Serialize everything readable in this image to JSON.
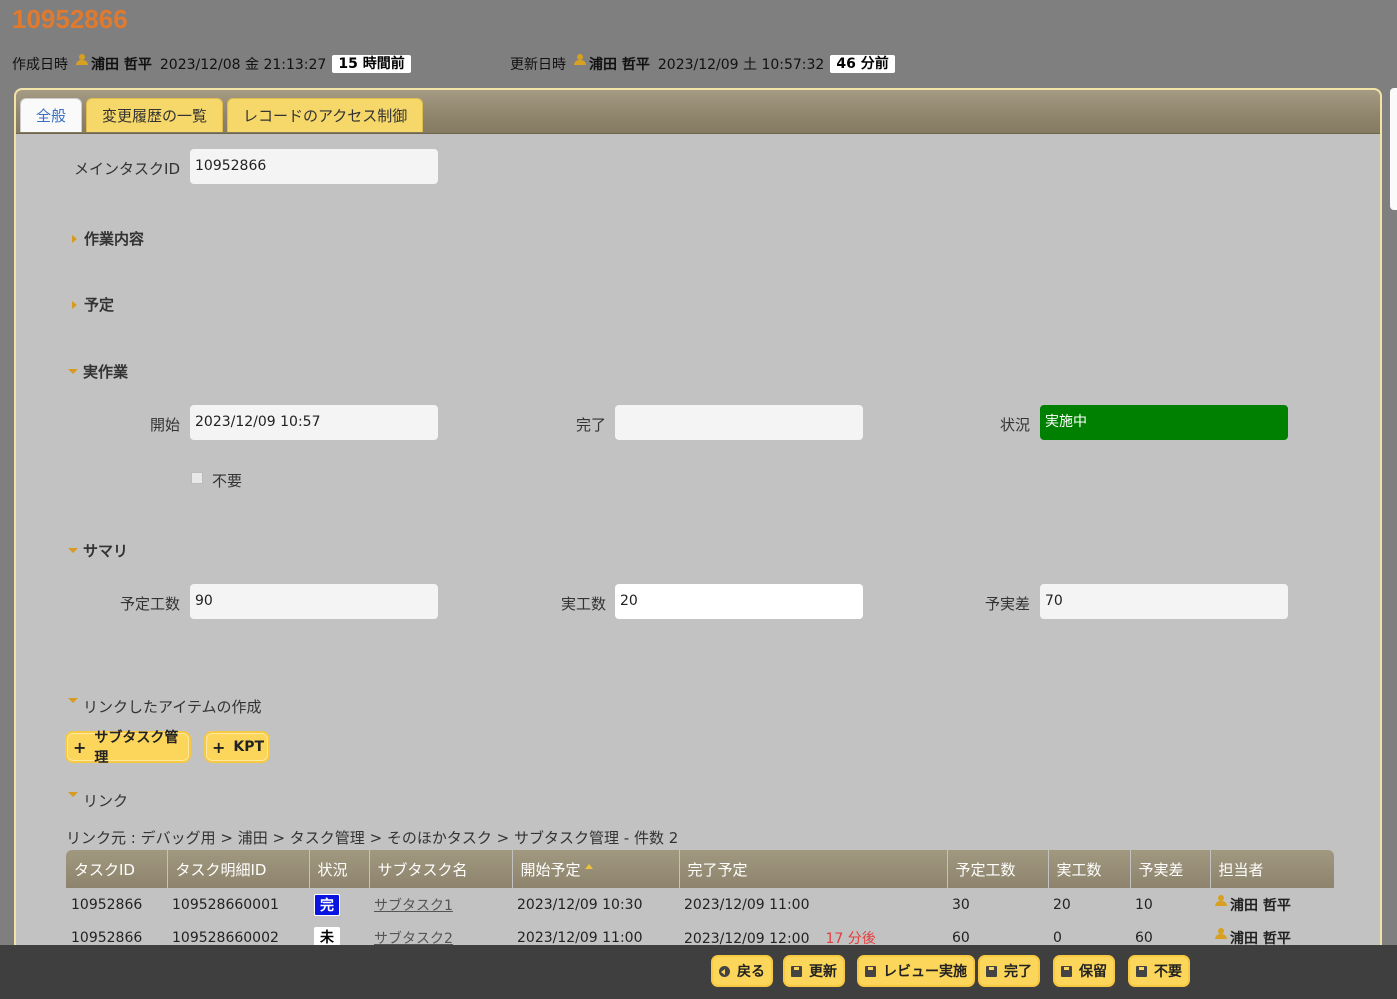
{
  "record": {
    "id": "10952866",
    "created_label": "作成日時",
    "created_user": "浦田 哲平",
    "created_date": "2023/12/08 金 21:13:27",
    "created_ago": "15 時間前",
    "updated_label": "更新日時",
    "updated_user": "浦田 哲平",
    "updated_date": "2023/12/09 土 10:57:32",
    "updated_ago": "46 分前"
  },
  "tabs": [
    {
      "label": "全般",
      "active": true
    },
    {
      "label": "変更履歴の一覧",
      "active": false
    },
    {
      "label": "レコードのアクセス制御",
      "active": false
    }
  ],
  "form": {
    "main_task_id_label": "メインタスクID",
    "main_task_id_value": "10952866",
    "sections": {
      "work_content": "作業内容",
      "plan": "予定",
      "actual": "実作業",
      "summary": "サマリ",
      "create_linked": "リンクしたアイテムの作成",
      "links": "リンク"
    },
    "start_label": "開始",
    "start_value": "2023/12/09 10:57",
    "complete_label": "完了",
    "complete_value": "",
    "status_label": "状況",
    "status_value": "実施中",
    "unneeded_label": "不要",
    "planned_hours_label": "予定工数",
    "planned_hours_value": "90",
    "actual_hours_label": "実工数",
    "actual_hours_value": "20",
    "diff_label": "予実差",
    "diff_value": "70"
  },
  "linked_buttons": {
    "subtask": "サブタスク管理",
    "kpt": "KPT"
  },
  "breadcrumb": "リンク元 : デバッグ用 > 浦田 > タスク管理 > そのほかタスク > サブタスク管理 - 件数 2",
  "table": {
    "headers": [
      "タスクID",
      "タスク明細ID",
      "状況",
      "サブタスク名",
      "開始予定",
      "完了予定",
      "予定工数",
      "実工数",
      "予実差",
      "担当者"
    ],
    "rows": [
      {
        "task_id": "10952866",
        "detail_id": "109528660001",
        "status": "完",
        "name": "サブタスク1",
        "start": "2023/12/09 10:30",
        "end": "2023/12/09 11:00",
        "end_rel": "",
        "planned": "30",
        "actual": "20",
        "diff": "10",
        "owner": "浦田 哲平"
      },
      {
        "task_id": "10952866",
        "detail_id": "109528660002",
        "status": "未",
        "name": "サブタスク2",
        "start": "2023/12/09 11:00",
        "end": "2023/12/09 12:00",
        "end_rel": "17 分後",
        "planned": "60",
        "actual": "0",
        "diff": "60",
        "owner": "浦田 哲平"
      }
    ]
  },
  "footer": {
    "back": "戻る",
    "update": "更新",
    "review": "レビュー実施",
    "complete": "完了",
    "hold": "保留",
    "unneeded": "不要"
  },
  "colors": {
    "accent_title": "#e07a2f",
    "button_yellow": "#fcd65a",
    "status_in_progress": "#008000",
    "status_done": "#0a14e0"
  }
}
